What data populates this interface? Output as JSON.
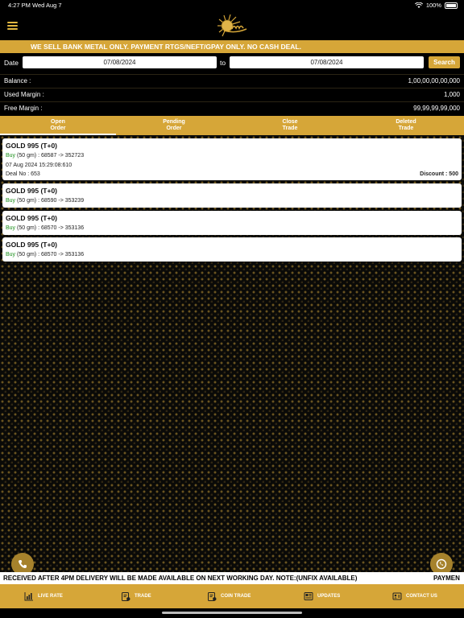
{
  "status": {
    "time": "4:27 PM",
    "day": "Wed Aug 7",
    "battery": "100%"
  },
  "marquee": "WE SELL BANK METAL ONLY. PAYMENT RTGS/NEFT/GPAY ONLY. NO CASH DEAL.",
  "filter": {
    "date_label": "Date",
    "from": "07/08/2024",
    "to_label": "to",
    "to": "07/08/2024",
    "search_label": "Search"
  },
  "balances": [
    {
      "key": "Balance :",
      "value": "1,00,00,00,00,000"
    },
    {
      "key": "Used Margin :",
      "value": "1,000"
    },
    {
      "key": "Free Margin :",
      "value": "99,99,99,99,000"
    }
  ],
  "tabs": [
    {
      "label_1": "Open",
      "label_2": "Order"
    },
    {
      "label_1": "Pending",
      "label_2": "Order"
    },
    {
      "label_1": "Close",
      "label_2": "Trade"
    },
    {
      "label_1": "Deleted",
      "label_2": "Trade"
    }
  ],
  "orders": [
    {
      "title": "GOLD 995 (T+0)",
      "side": "Buy",
      "detail": " (50 gm) : 68587 -> 352723",
      "datetime": "07 Aug 2024 15:29:08:610",
      "deal": "Deal No : 653",
      "discount": "Discount : 500"
    },
    {
      "title": "GOLD 995 (T+0)",
      "side": "Buy",
      "detail": " (50 gm) : 68590 -> 353239"
    },
    {
      "title": "GOLD 995 (T+0)",
      "side": "Buy",
      "detail": " (50 gm) : 68570 -> 353136"
    },
    {
      "title": "GOLD 995 (T+0)",
      "side": "Buy",
      "detail": " (50 gm) : 68570 -> 353136"
    }
  ],
  "ticker": {
    "text1": "RECEIVED AFTER 4PM DELIVERY WILL BE MADE AVAILABLE ON NEXT WORKING DAY.  NOTE:(UNFIX AVAILABLE)",
    "text2": "PAYMEN"
  },
  "nav": [
    "LIVE RATE",
    "TRADE",
    "COIN TRADE",
    "UPDATES",
    "CONTACT US"
  ],
  "colors": {
    "accent": "#d6a638",
    "buy": "#1a8f1a"
  }
}
